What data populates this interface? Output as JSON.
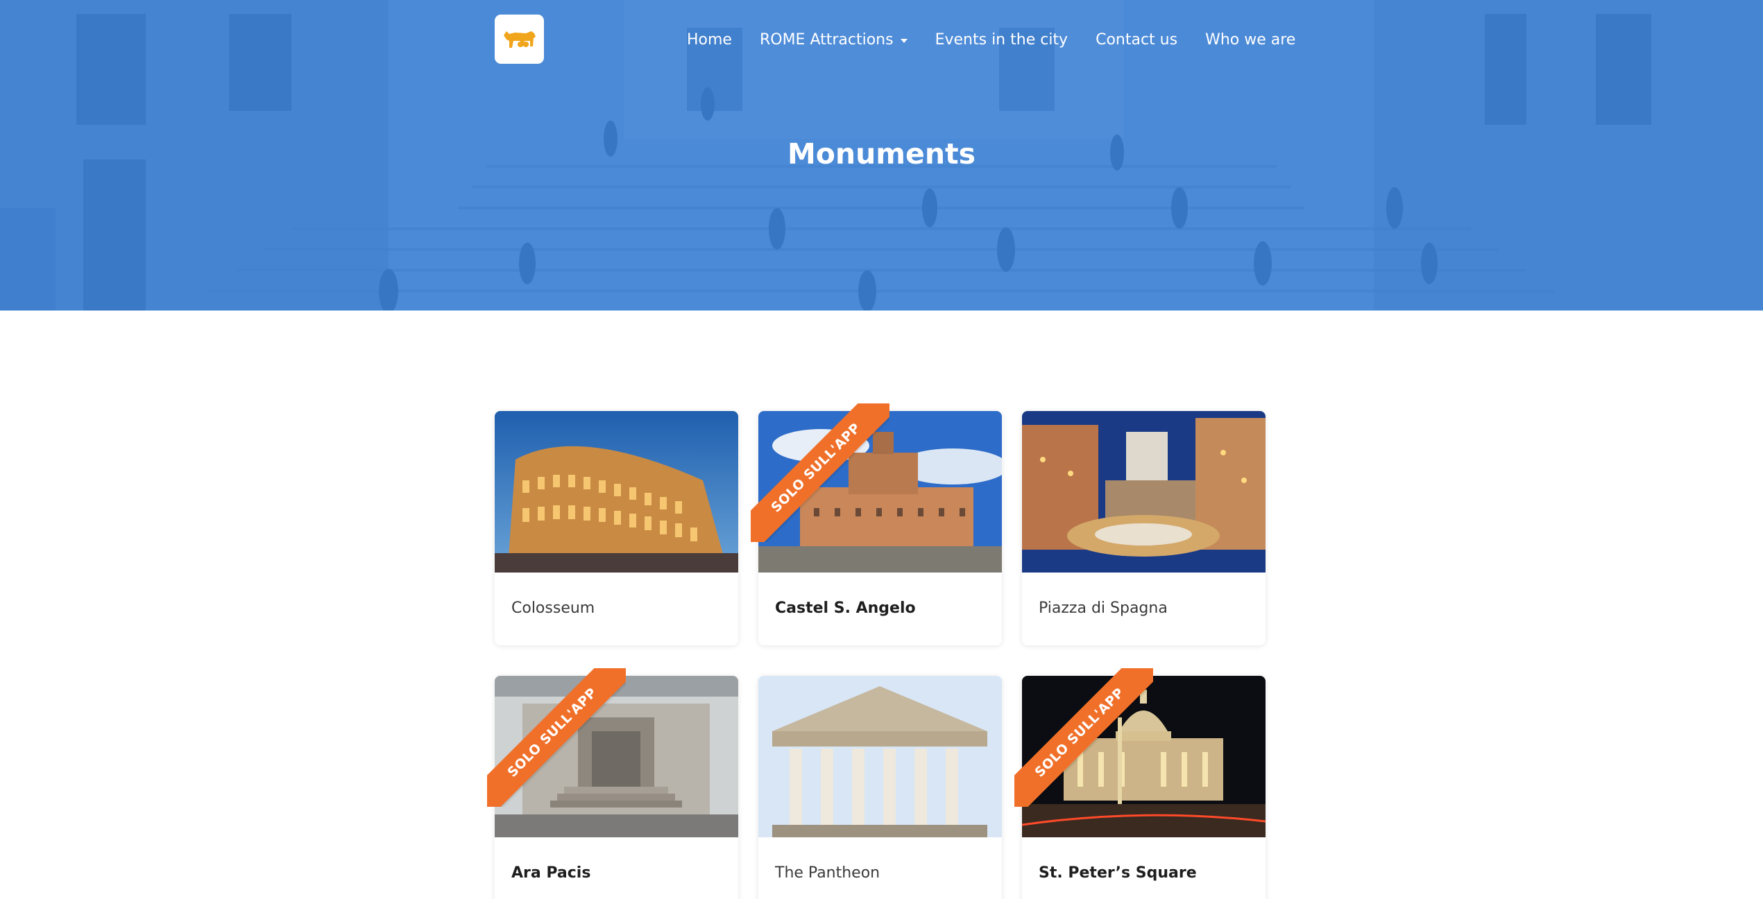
{
  "header": {
    "logo_icon": "she-wolf-icon",
    "nav": [
      {
        "label": "Home"
      },
      {
        "label": "ROME Attractions",
        "has_dropdown": true
      },
      {
        "label": "Events in the city"
      },
      {
        "label": "Contact us"
      },
      {
        "label": "Who we are"
      }
    ],
    "page_title": "Monuments"
  },
  "colors": {
    "hero_overlay": "#3a88e6",
    "ribbon": "#f0702a",
    "logo_accent": "#f0a51c"
  },
  "cards": [
    {
      "name": "Colosseum",
      "ribbon": null
    },
    {
      "name": "Castel S. Angelo",
      "ribbon": "SOLO SULL'APP"
    },
    {
      "name": "Piazza di Spagna",
      "ribbon": null
    },
    {
      "name": "Ara Pacis",
      "ribbon": "SOLO SULL'APP"
    },
    {
      "name": "The Pantheon",
      "ribbon": null
    },
    {
      "name": "St. Peter’s Square",
      "ribbon": "SOLO SULL'APP"
    }
  ]
}
